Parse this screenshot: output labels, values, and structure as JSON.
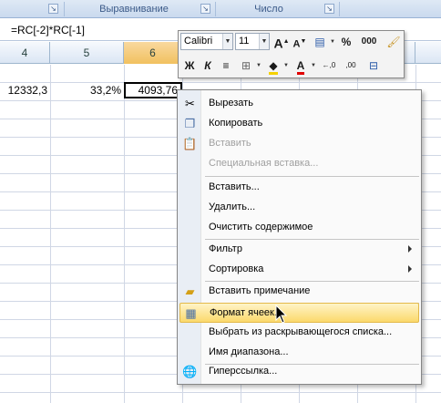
{
  "ribbon": {
    "groups": [
      {
        "label": ""
      },
      {
        "label": "Выравнивание"
      },
      {
        "label": "Число"
      }
    ]
  },
  "formula_bar": {
    "formula": "=RC[-2]*RC[-1]"
  },
  "columns": [
    "4",
    "5",
    "6"
  ],
  "cells": {
    "c4": "12332,3",
    "c5": "33,2%",
    "c6": "4093,76"
  },
  "mini_toolbar": {
    "font_name": "Calibri",
    "font_size": "11",
    "grow_font": "A",
    "shrink_font": "A",
    "percent": "%",
    "thousands": "000",
    "bold": "Ж",
    "italic": "К",
    "font_color_letter": "А",
    "dec_inc": "←,0",
    "dec_dec": ",00"
  },
  "context_menu": {
    "items": [
      {
        "label": "Вырезать",
        "icon": "scissors-icon",
        "disabled": false
      },
      {
        "label": "Копировать",
        "icon": "copy-icon",
        "disabled": false
      },
      {
        "label": "Вставить",
        "icon": "paste-icon",
        "disabled": true
      },
      {
        "label": "Специальная вставка...",
        "icon": "",
        "disabled": true
      },
      {
        "label": "Вставить...",
        "icon": "",
        "disabled": false
      },
      {
        "label": "Удалить...",
        "icon": "",
        "disabled": false
      },
      {
        "label": "Очистить содержимое",
        "icon": "",
        "disabled": false
      },
      {
        "label": "Фильтр",
        "icon": "",
        "disabled": false,
        "submenu": true
      },
      {
        "label": "Сортировка",
        "icon": "",
        "disabled": false,
        "submenu": true
      },
      {
        "label": "Вставить примечание",
        "icon": "note-icon",
        "disabled": false
      },
      {
        "label": "Формат ячеек...",
        "icon": "format-cells-icon",
        "disabled": false,
        "highlight": true
      },
      {
        "label": "Выбрать из раскрывающегося списка...",
        "icon": "",
        "disabled": false
      },
      {
        "label": "Имя диапазона...",
        "icon": "",
        "disabled": false
      },
      {
        "label": "Гиперссылка...",
        "icon": "hyperlink-icon",
        "disabled": false
      }
    ]
  },
  "colors": {
    "highlight": "#fbd96c",
    "active_column": "#f1c15f",
    "ribbon_text": "#3b5a88"
  }
}
